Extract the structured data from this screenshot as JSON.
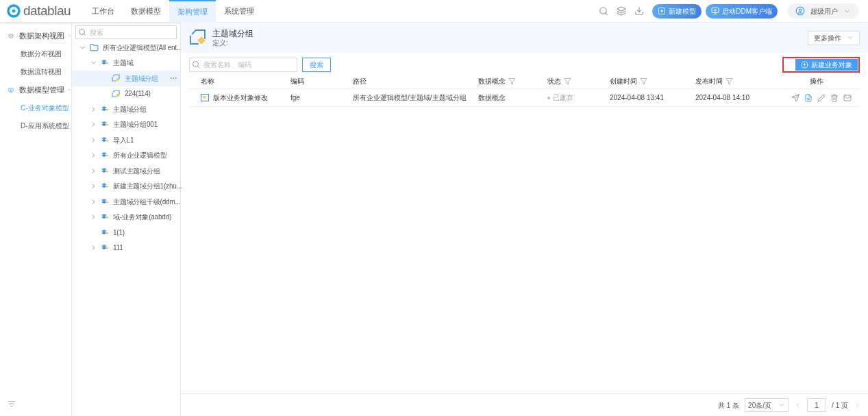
{
  "logo": {
    "text": "datablau"
  },
  "nav_tabs": [
    {
      "label": "工作台",
      "selected": false
    },
    {
      "label": "数据模型",
      "selected": false
    },
    {
      "label": "架构管理",
      "selected": true
    },
    {
      "label": "系统管理",
      "selected": false
    }
  ],
  "header_actions": {
    "new_model": "新建模型",
    "launch_client": "启动DDM客户端",
    "user": "超级用户"
  },
  "sidebar": {
    "sections": [
      {
        "label": "数据架构视图",
        "kind": "cube",
        "expanded": true,
        "items": [
          {
            "label": "数据分布视图",
            "selected": false
          },
          {
            "label": "数据流转视图",
            "selected": false
          }
        ]
      },
      {
        "label": "数据模型管理",
        "kind": "model",
        "expanded": true,
        "items": [
          {
            "label": "C-业务对象模型",
            "selected": true
          },
          {
            "label": "D-应用系统模型",
            "selected": false
          }
        ]
      }
    ]
  },
  "tree": {
    "search_placeholder": "搜索",
    "nodes": [
      {
        "label": "所有企业逻辑模型(All ent...",
        "kind": "folder",
        "expandable": true,
        "expanded": true,
        "selected": false,
        "children": [
          {
            "label": "主题域",
            "kind": "domain",
            "expandable": true,
            "expanded": true,
            "selected": false,
            "children": [
              {
                "label": "主题域分组",
                "kind": "group",
                "expandable": false,
                "expanded": false,
                "selected": true
              },
              {
                "label": "224(114)",
                "kind": "group",
                "expandable": false,
                "expanded": false,
                "selected": false
              }
            ]
          },
          {
            "label": "主题域分组",
            "kind": "domain",
            "expandable": true,
            "expanded": false,
            "selected": false
          },
          {
            "label": "主题域分组001",
            "kind": "domain",
            "expandable": true,
            "expanded": false,
            "selected": false
          },
          {
            "label": "导入L1",
            "kind": "domain",
            "expandable": true,
            "expanded": false,
            "selected": false
          },
          {
            "label": "所有企业逻辑模型",
            "kind": "domain",
            "expandable": true,
            "expanded": false,
            "selected": false
          },
          {
            "label": "测试主题域分组",
            "kind": "domain",
            "expandable": true,
            "expanded": false,
            "selected": false
          },
          {
            "label": "新建主题域分组1(zhu...",
            "kind": "domain",
            "expandable": true,
            "expanded": false,
            "selected": false
          },
          {
            "label": "主题域分组千级(ddm...",
            "kind": "domain",
            "expandable": true,
            "expanded": false,
            "selected": false
          },
          {
            "label": "域-业务对象(aabdd)",
            "kind": "domain",
            "expandable": true,
            "expanded": false,
            "selected": false
          },
          {
            "label": "1(1)",
            "kind": "domain",
            "expandable": false,
            "expanded": false,
            "selected": false
          },
          {
            "label": "111",
            "kind": "domain",
            "expandable": true,
            "expanded": false,
            "selected": false
          }
        ]
      }
    ]
  },
  "detail": {
    "title": "主题域分组",
    "definition": "定义:",
    "more_actions": "更多操作",
    "search_placeholder": "搜索名称、编码",
    "search_button": "搜索",
    "new_object_button": "新建业务对象"
  },
  "table": {
    "columns": [
      {
        "label": "名称",
        "filter": false
      },
      {
        "label": "编码",
        "filter": false
      },
      {
        "label": "路径",
        "filter": false
      },
      {
        "label": "数据概念",
        "filter": true
      },
      {
        "label": "状态",
        "filter": true
      },
      {
        "label": "创建时间",
        "filter": true
      },
      {
        "label": "发布时间",
        "filter": true
      },
      {
        "label": "操作",
        "filter": false
      }
    ],
    "rows": [
      {
        "name": "版本业务对象修改",
        "code": "fge",
        "path": "所有企业逻辑模型/主题域/主题域分组",
        "concept": "数据概念",
        "status": "已废弃",
        "created": "2024-04-08 13:41",
        "published": "2024-04-08 14:10"
      }
    ]
  },
  "pagination": {
    "total": "共 1 条",
    "page_size": "20条/页",
    "page": "1",
    "pages": "/ 1 页"
  }
}
